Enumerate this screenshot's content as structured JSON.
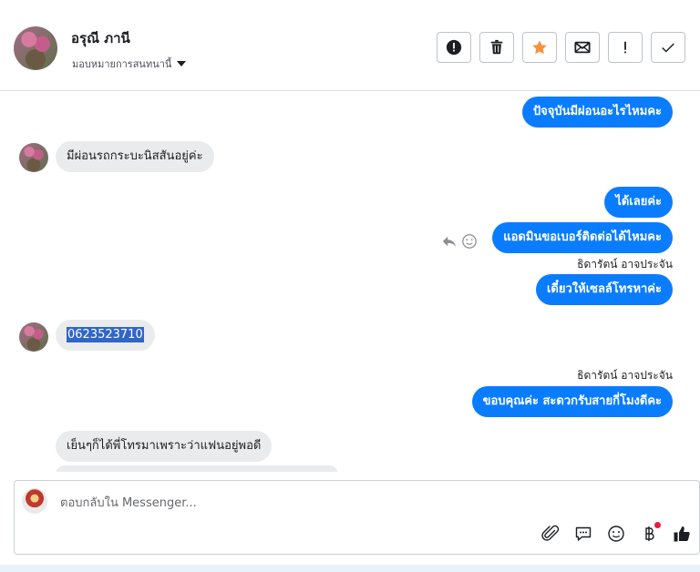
{
  "contact": {
    "name": "อรุณี ภานี",
    "assign_label": "มอบหมายการสนทนานี้"
  },
  "actions": [
    {
      "name": "spam-button",
      "icon": "alert-circle-icon"
    },
    {
      "name": "delete-button",
      "icon": "trash-icon"
    },
    {
      "name": "star-button",
      "icon": "star-icon"
    },
    {
      "name": "mark-unread-button",
      "icon": "mail-icon"
    },
    {
      "name": "follow-up-button",
      "icon": "exclamation-icon"
    },
    {
      "name": "done-button",
      "icon": "check-icon"
    }
  ],
  "messages": {
    "m1": "ปัจจุบันมีผ่อนอะไรไหมคะ",
    "m2": "มีผ่อนรถกระบะนิสสันอยู่ค่ะ",
    "m3": "ได้เลยค่ะ",
    "m4": "แอดมินขอเบอร์ติดต่อได้ไหมคะ",
    "sender1": "ธิดารัตน์ อาจประจัน",
    "m5": "เดี๋ยวให้เซลล์โทรหาค่ะ",
    "m6": "0623523710",
    "sender2": "ธิดารัตน์ อาจประจัน",
    "m7": "ขอบคุณค่ะ สะดวกรับสายกี่โมงดีคะ",
    "m8": "เย็นๆก็ได้พี่โทรมาเพราะว่าแฟนอยู่พอดี"
  },
  "composer": {
    "placeholder": "ตอบกลับใน Messenger..."
  },
  "colors": {
    "accent": "#0a7cff",
    "star": "#f7923a",
    "notification_dot": "#e41e3f"
  }
}
